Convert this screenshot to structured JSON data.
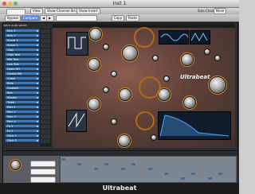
{
  "window": {
    "title": "Inst 1"
  },
  "toolbar": {
    "bypass_label": "Bypass",
    "compare_label": "Compare",
    "view_label": "View",
    "show_channel_strip_label": "Show Channel Strip",
    "show_insert_label": "Show Insert",
    "copy_label": "Copy",
    "paste_label": "Paste",
    "side_chain_label": "Side Chain",
    "side_chain_value": "None"
  },
  "plugin": {
    "name": "Ultrabeat",
    "brand_label": "Ultrabeat"
  },
  "voice_list": {
    "header": "voice auto select",
    "items": [
      "Kick 1",
      "Kick 2",
      "Snare 1",
      "Snare 2",
      "Clap",
      "High Tom",
      "Mid Tom",
      "Low Tom",
      "Open HH",
      "Closed HH",
      "Crash",
      "Ride",
      "Cowbell",
      "Rim",
      "Shaker",
      "Tamb",
      "Perc 1",
      "Perc 2",
      "Perc 3",
      "Perc 4",
      "Fx 1",
      "Fx 2",
      "Click 1",
      "Click 2"
    ]
  },
  "colors": {
    "voice_blue": "#3c79b8",
    "accent_orange": "#c98a2a"
  }
}
